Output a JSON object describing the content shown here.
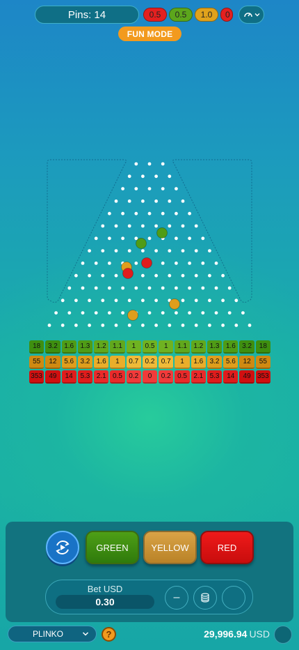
{
  "header": {
    "pins_label": "Pins: 14",
    "history": [
      {
        "value": "0.5",
        "color": "red"
      },
      {
        "value": "0.5",
        "color": "green"
      },
      {
        "value": "1.0",
        "color": "yellow"
      },
      {
        "value": "0",
        "color": "red"
      }
    ],
    "history_icon": "history-gauge-icon",
    "mode_badge": "FUN MODE"
  },
  "board": {
    "pin_rows": 14,
    "balls": [
      {
        "color": "green"
      },
      {
        "color": "green"
      },
      {
        "color": "red"
      },
      {
        "color": "yellow"
      },
      {
        "color": "red"
      },
      {
        "color": "yellow"
      },
      {
        "color": "yellow"
      }
    ],
    "multipliers": {
      "green": [
        "18",
        "3.2",
        "1.6",
        "1.3",
        "1.2",
        "1.1",
        "1",
        "0.5",
        "1",
        "1.1",
        "1.2",
        "1.3",
        "1.6",
        "3.2",
        "18"
      ],
      "yellow": [
        "55",
        "12",
        "5.6",
        "3.2",
        "1.6",
        "1",
        "0.7",
        "0.2",
        "0.7",
        "1",
        "1.6",
        "3.2",
        "5.6",
        "12",
        "55"
      ],
      "red": [
        "353",
        "49",
        "14",
        "5.3",
        "2.1",
        "0.5",
        "0.2",
        "0",
        "0.2",
        "0.5",
        "2.1",
        "5.3",
        "14",
        "49",
        "353"
      ]
    }
  },
  "controls": {
    "autoplay_icon": "autoplay-refresh-icon",
    "green_label": "GREEN",
    "yellow_label": "YELLOW",
    "red_label": "RED",
    "bet_label": "Bet USD",
    "bet_value": "0.30",
    "minus_label": "–",
    "coins_icon": "coins-stack-icon"
  },
  "footer": {
    "game_name": "PLINKO",
    "help_label": "?",
    "balance_amount": "29,996.94",
    "balance_currency": "USD"
  },
  "colors": {
    "green": "#4f9c16",
    "yellow": "#df9e1c",
    "red": "#e01c1c",
    "accent": "#f29a1e"
  }
}
